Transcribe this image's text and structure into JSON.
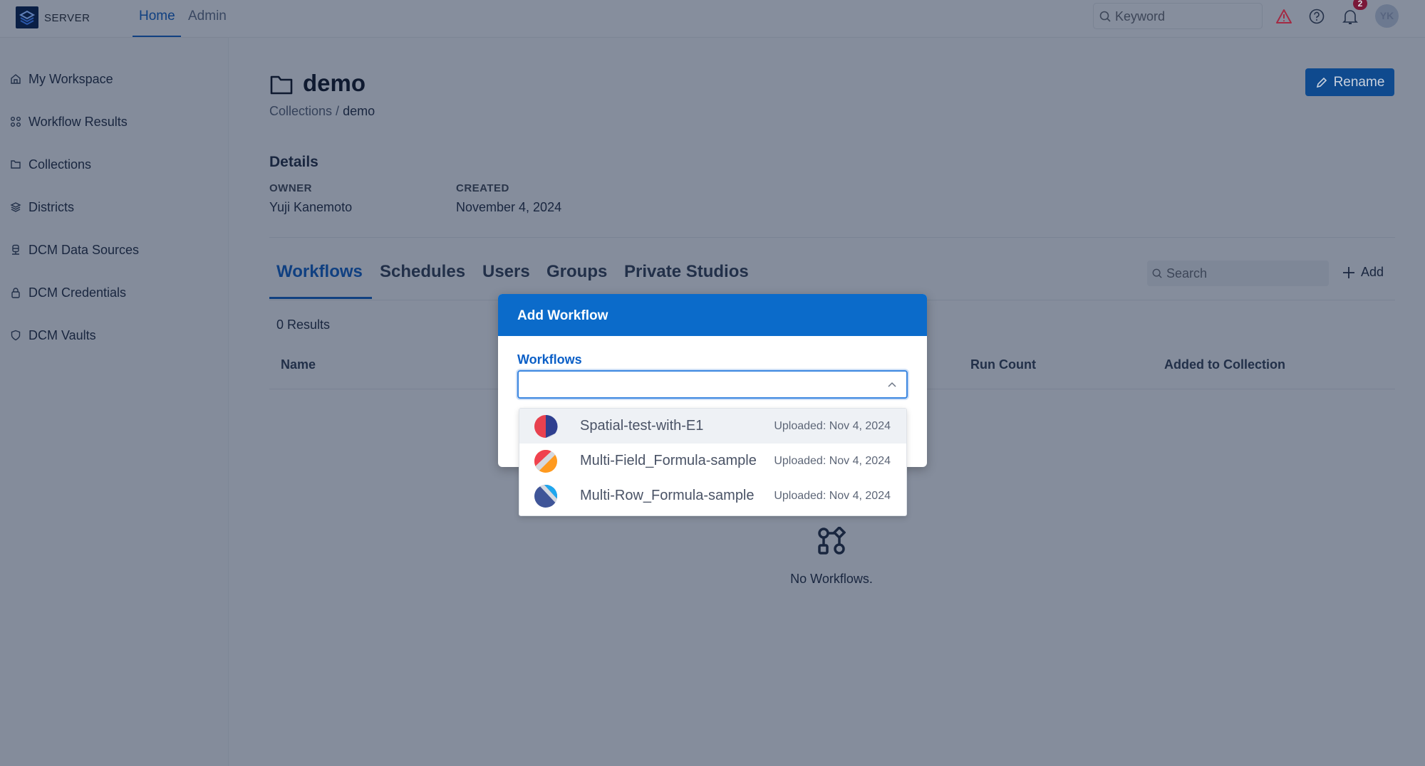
{
  "header": {
    "brand": "SERVER",
    "nav": [
      {
        "label": "Home",
        "active": true
      },
      {
        "label": "Admin"
      }
    ],
    "search_placeholder": "Keyword",
    "notification_count": "2",
    "avatar_initials": "YK",
    "icons": [
      "warning-icon",
      "help-icon",
      "bell-icon"
    ]
  },
  "sidebar": {
    "items": [
      {
        "label": "My Workspace",
        "icon": "home-icon"
      },
      {
        "label": "Workflow Results",
        "icon": "workflow-icon"
      },
      {
        "label": "Collections",
        "icon": "folder-icon"
      },
      {
        "label": "Districts",
        "icon": "layers-icon"
      },
      {
        "label": "DCM Data Sources",
        "icon": "database-icon"
      },
      {
        "label": "DCM Credentials",
        "icon": "lock-icon"
      },
      {
        "label": "DCM Vaults",
        "icon": "shield-icon"
      }
    ]
  },
  "page": {
    "title": "demo",
    "breadcrumb": {
      "parent": "Collections",
      "separator": " / ",
      "current": "demo"
    },
    "rename_label": "Rename",
    "details": {
      "heading": "Details",
      "owner_label": "OWNER",
      "owner": "Yuji Kanemoto",
      "created_label": "CREATED",
      "created": "November 4, 2024"
    },
    "tabs": [
      {
        "label": "Workflows",
        "active": true
      },
      {
        "label": "Schedules"
      },
      {
        "label": "Users"
      },
      {
        "label": "Groups"
      },
      {
        "label": "Private Studios"
      }
    ],
    "search_placeholder": "Search",
    "add_label": "Add",
    "results": "0 Results",
    "columns": [
      "Name",
      "Run Count",
      "Added to Collection"
    ],
    "empty": "No Workflows."
  },
  "modal": {
    "title": "Add Workflow",
    "field_label": "Workflows",
    "value": "",
    "options": [
      {
        "name": "Spatial-test-with-E1",
        "uploaded": "Uploaded: Nov 4, 2024",
        "colors": [
          "#e8414f",
          "#2f3f8f"
        ]
      },
      {
        "name": "Multi-Field_Formula-sample",
        "uploaded": "Uploaded: Nov 4, 2024",
        "colors": [
          "#f0424f",
          "#ff9a1f"
        ]
      },
      {
        "name": "Multi-Row_Formula-sample",
        "uploaded": "Uploaded: Nov 4, 2024",
        "colors": [
          "#1ea7ef",
          "#3f5598"
        ]
      }
    ]
  },
  "colors": {
    "accent": "#0b5fc7",
    "modal_header": "#0b6bca",
    "badge": "#c0143c"
  }
}
